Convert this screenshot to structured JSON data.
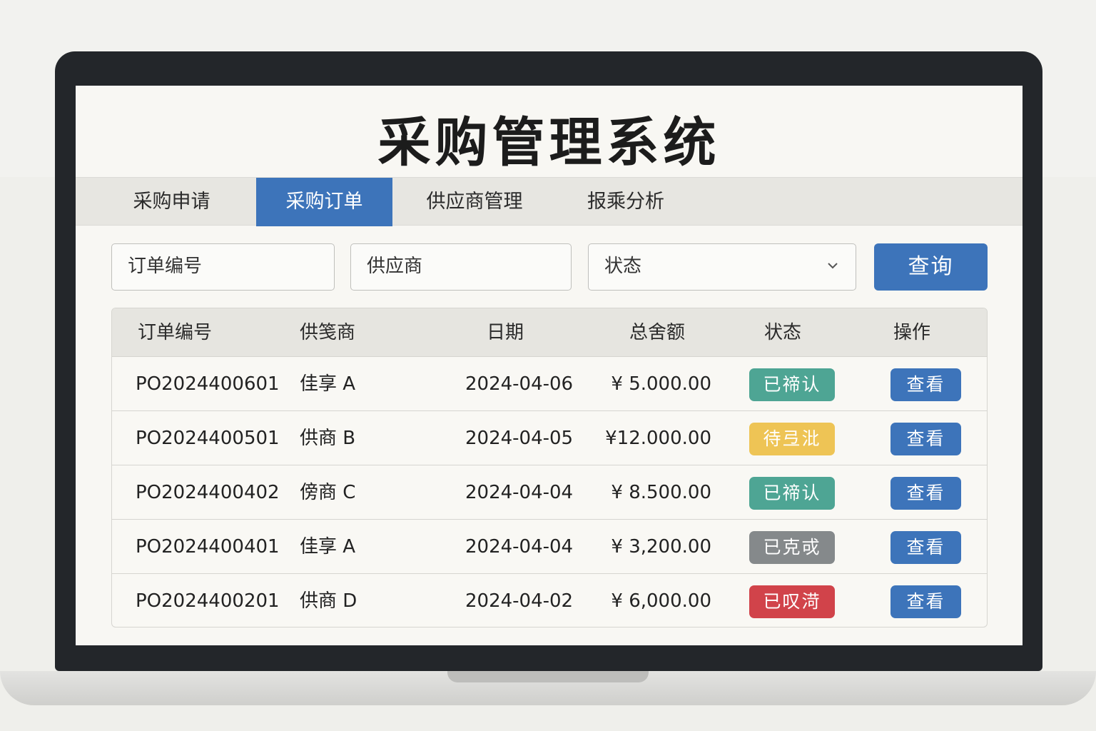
{
  "app": {
    "title": "采购管理系统"
  },
  "tabs": [
    {
      "label": "采购申请",
      "active": false
    },
    {
      "label": "采购订单",
      "active": true
    },
    {
      "label": "供应商管理",
      "active": false
    },
    {
      "label": "报乘分析",
      "active": false
    }
  ],
  "filters": {
    "order_no_placeholder": "订单编号",
    "supplier_placeholder": "供应商",
    "status_value": "状态",
    "status_icon": "chevron-down-icon",
    "query_label": "查询"
  },
  "table": {
    "headers": [
      "订单编号",
      "供笺商",
      "日期",
      "总舍额",
      "状态",
      "操作"
    ],
    "rows": [
      {
        "order_no": "PO2024400601",
        "supplier": "佳享 A",
        "date": "2024-04-06",
        "amount": "¥ 5.000.00",
        "status": "已禘认",
        "status_color": "#4ea594",
        "action": "查看"
      },
      {
        "order_no": "PO2024400501",
        "supplier": "供商 B",
        "date": "2024-04-05",
        "amount": "¥12.000.00",
        "status": "待弖沘",
        "status_color": "#eec455",
        "action": "查看"
      },
      {
        "order_no": "PO2024400402",
        "supplier": "傍商 C",
        "date": "2024-04-04",
        "amount": "¥ 8.500.00",
        "status": "已禘认",
        "status_color": "#4ea594",
        "action": "查看"
      },
      {
        "order_no": "PO2024400401",
        "supplier": "佳享 A",
        "date": "2024-04-04",
        "amount": "¥ 3,200.00",
        "status": "已克戓",
        "status_color": "#85898b",
        "action": "查看"
      },
      {
        "order_no": "PO2024400201",
        "supplier": "供商 D",
        "date": "2024-04-02",
        "amount": "¥ 6,000.00",
        "status": "已叹渮",
        "status_color": "#d1434a",
        "action": "查看"
      }
    ]
  },
  "colors": {
    "accent": "#3d74ba",
    "bezel": "#23262a"
  }
}
